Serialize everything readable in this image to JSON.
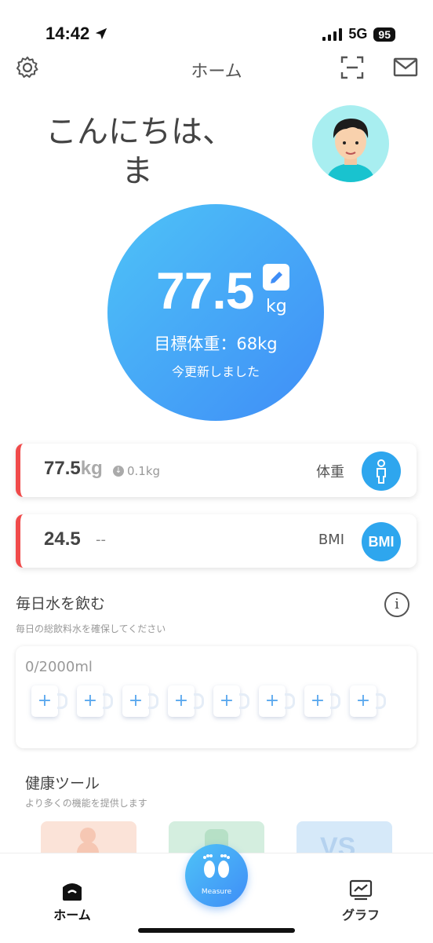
{
  "status": {
    "time": "14:42",
    "network": "5G",
    "battery": "95"
  },
  "nav": {
    "title": "ホーム"
  },
  "greeting": {
    "line1": "こんにちは、",
    "line2": "ま"
  },
  "weight_panel": {
    "value": "77.5",
    "unit": "kg",
    "goal": "目標体重：68kg",
    "updated": "今更新しました"
  },
  "cards": [
    {
      "value": "77.5",
      "unit": "kg",
      "delta": "0.1kg",
      "label": "体重",
      "icon": "person-icon"
    },
    {
      "value": "24.5",
      "extra": "--",
      "label": "BMI",
      "icon_text": "BMI"
    }
  ],
  "water": {
    "title": "毎日水を飲む",
    "subtitle": "毎日の総飲料水を確保してください",
    "amount": "0/2000ml",
    "cups": [
      "+",
      "+",
      "+",
      "+",
      "+",
      "+",
      "+",
      "+"
    ]
  },
  "tools": {
    "title": "健康ツール",
    "subtitle": "より多くの機能を提供します"
  },
  "tabbar": {
    "home": "ホーム",
    "measure": "Measure",
    "graph": "グラフ"
  },
  "colors": {
    "accent": "#3f8df7",
    "alert": "#f04a4a"
  }
}
